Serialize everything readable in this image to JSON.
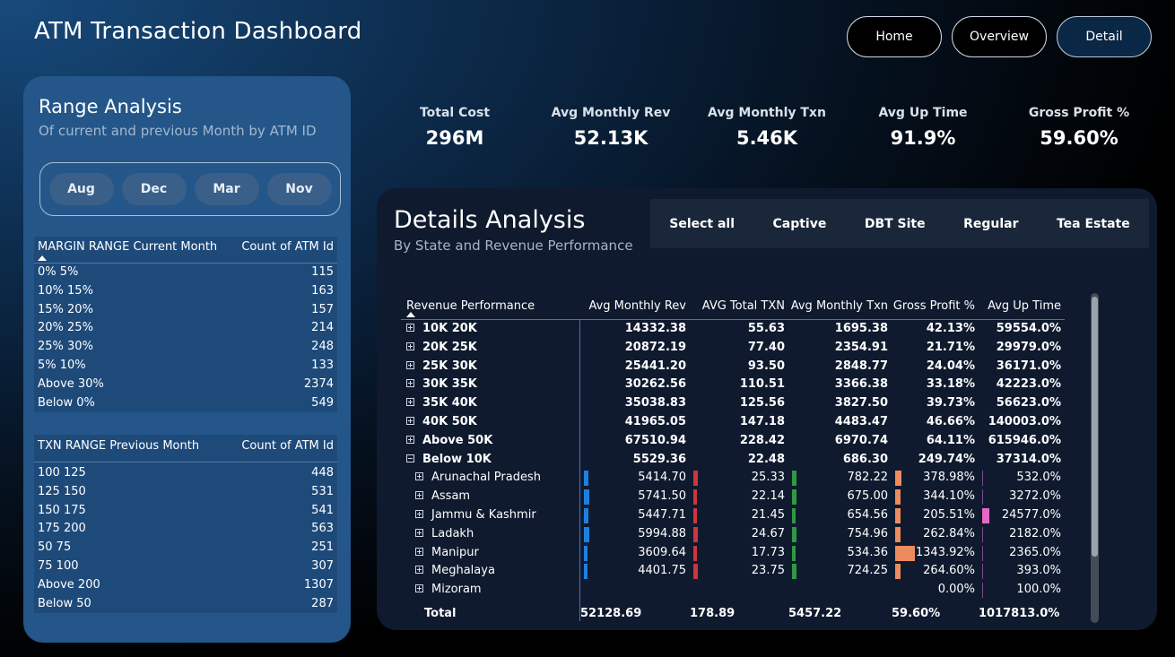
{
  "app": {
    "title": "ATM Transaction Dashboard"
  },
  "nav": {
    "home": "Home",
    "overview": "Overview",
    "detail": "Detail"
  },
  "range": {
    "title": "Range Analysis",
    "subtitle": "Of current and previous Month by ATM ID",
    "months": [
      "Aug",
      "Dec",
      "Mar",
      "Nov"
    ],
    "margin_table": {
      "col1": "MARGIN RANGE Current Month",
      "col2": "Count of ATM Id",
      "rows": [
        {
          "label": "0% 5%",
          "count": "115"
        },
        {
          "label": "10% 15%",
          "count": "163"
        },
        {
          "label": "15% 20%",
          "count": "157"
        },
        {
          "label": "20% 25%",
          "count": "214"
        },
        {
          "label": "25% 30%",
          "count": "248"
        },
        {
          "label": "5% 10%",
          "count": "133"
        },
        {
          "label": "Above 30%",
          "count": "2374"
        },
        {
          "label": "Below 0%",
          "count": "549"
        }
      ]
    },
    "txn_table": {
      "col1": "TXN RANGE Previous Month",
      "col2": "Count of ATM Id",
      "rows": [
        {
          "label": "100 125",
          "count": "448"
        },
        {
          "label": "125 150",
          "count": "531"
        },
        {
          "label": "150 175",
          "count": "541"
        },
        {
          "label": "175 200",
          "count": "563"
        },
        {
          "label": "50 75",
          "count": "251"
        },
        {
          "label": "75 100",
          "count": "307"
        },
        {
          "label": "Above 200",
          "count": "1307"
        },
        {
          "label": "Below 50",
          "count": "287"
        }
      ]
    }
  },
  "kpis": [
    {
      "label": "Total Cost",
      "value": "296M"
    },
    {
      "label": "Avg Monthly Rev",
      "value": "52.13K"
    },
    {
      "label": "Avg Monthly Txn",
      "value": "5.46K"
    },
    {
      "label": "Avg Up Time",
      "value": "91.9%"
    },
    {
      "label": "Gross Profit %",
      "value": "59.60%"
    }
  ],
  "details": {
    "title": "Details Analysis",
    "subtitle": "By State and Revenue Performance",
    "slicer": [
      "Select all",
      "Captive",
      "DBT Site",
      "Regular",
      "Tea Estate"
    ],
    "columns": [
      "Revenue Performance",
      "Avg Monthly Rev",
      "AVG Total TXN",
      "Avg Monthly Txn",
      "Gross Profit %",
      "Avg Up Time"
    ],
    "groups": [
      {
        "label": "10K 20K",
        "rev": "14332.38",
        "txn": "55.63",
        "mtxn": "1695.38",
        "gp": "42.13%",
        "up": "59554.0%"
      },
      {
        "label": "20K 25K",
        "rev": "20872.19",
        "txn": "77.40",
        "mtxn": "2354.91",
        "gp": "21.71%",
        "up": "29979.0%"
      },
      {
        "label": "25K 30K",
        "rev": "25441.20",
        "txn": "93.50",
        "mtxn": "2848.77",
        "gp": "24.04%",
        "up": "36171.0%"
      },
      {
        "label": "30K 35K",
        "rev": "30262.56",
        "txn": "110.51",
        "mtxn": "3366.38",
        "gp": "33.18%",
        "up": "42223.0%"
      },
      {
        "label": "35K 40K",
        "rev": "35038.83",
        "txn": "125.56",
        "mtxn": "3827.50",
        "gp": "39.73%",
        "up": "56623.0%"
      },
      {
        "label": "40K 50K",
        "rev": "41965.05",
        "txn": "147.18",
        "mtxn": "4483.47",
        "gp": "46.66%",
        "up": "140003.0%"
      },
      {
        "label": "Above 50K",
        "rev": "67510.94",
        "txn": "228.42",
        "mtxn": "6970.74",
        "gp": "64.11%",
        "up": "615946.0%"
      }
    ],
    "expanded": {
      "label": "Below 10K",
      "rev": "5529.36",
      "txn": "22.48",
      "mtxn": "686.30",
      "gp": "249.74%",
      "up": "37314.0%"
    },
    "states": [
      {
        "label": "Arunachal Pradesh",
        "rev": "5414.70",
        "txn": "25.33",
        "mtxn": "782.22",
        "gp": "378.98%",
        "up": "532.0%",
        "rev_v": 5414.7,
        "txn_v": 25.33,
        "mtxn_v": 782.22,
        "gp_v": 378.98,
        "up_v": 532.0
      },
      {
        "label": "Assam",
        "rev": "5741.50",
        "txn": "22.14",
        "mtxn": "675.00",
        "gp": "344.10%",
        "up": "3272.0%",
        "rev_v": 5741.5,
        "txn_v": 22.14,
        "mtxn_v": 675.0,
        "gp_v": 344.1,
        "up_v": 3272.0
      },
      {
        "label": "Jammu & Kashmir",
        "rev": "5447.71",
        "txn": "21.45",
        "mtxn": "654.56",
        "gp": "205.51%",
        "up": "24577.0%",
        "rev_v": 5447.71,
        "txn_v": 21.45,
        "mtxn_v": 654.56,
        "gp_v": 205.51,
        "up_v": 24577.0
      },
      {
        "label": "Ladakh",
        "rev": "5994.88",
        "txn": "24.67",
        "mtxn": "754.96",
        "gp": "262.84%",
        "up": "2182.0%",
        "rev_v": 5994.88,
        "txn_v": 24.67,
        "mtxn_v": 754.96,
        "gp_v": 262.84,
        "up_v": 2182.0
      },
      {
        "label": "Manipur",
        "rev": "3609.64",
        "txn": "17.73",
        "mtxn": "534.36",
        "gp": "1343.92%",
        "up": "2365.0%",
        "rev_v": 3609.64,
        "txn_v": 17.73,
        "mtxn_v": 534.36,
        "gp_v": 1343.92,
        "up_v": 2365.0
      },
      {
        "label": "Meghalaya",
        "rev": "4401.75",
        "txn": "23.75",
        "mtxn": "724.25",
        "gp": "264.60%",
        "up": "393.0%",
        "rev_v": 4401.75,
        "txn_v": 23.75,
        "mtxn_v": 724.25,
        "gp_v": 264.6,
        "up_v": 393.0
      },
      {
        "label": "Mizoram",
        "rev": "",
        "txn": "",
        "mtxn": "",
        "gp": "0.00%",
        "up": "100.0%",
        "rev_v": 0,
        "txn_v": 0,
        "mtxn_v": 0,
        "gp_v": 0,
        "up_v": 100.0
      }
    ],
    "total": {
      "label": "Total",
      "rev": "52128.69",
      "txn": "178.89",
      "mtxn": "5457.22",
      "gp": "59.60%",
      "up": "1017813.0%"
    }
  },
  "colors": {
    "rev_bar": "#1f7fe0",
    "txn_bar": "#d0343f",
    "mtxn_bar": "#2d9a3f",
    "gp_bar": "#ec8b5e",
    "up_bar": "#e469c6"
  }
}
